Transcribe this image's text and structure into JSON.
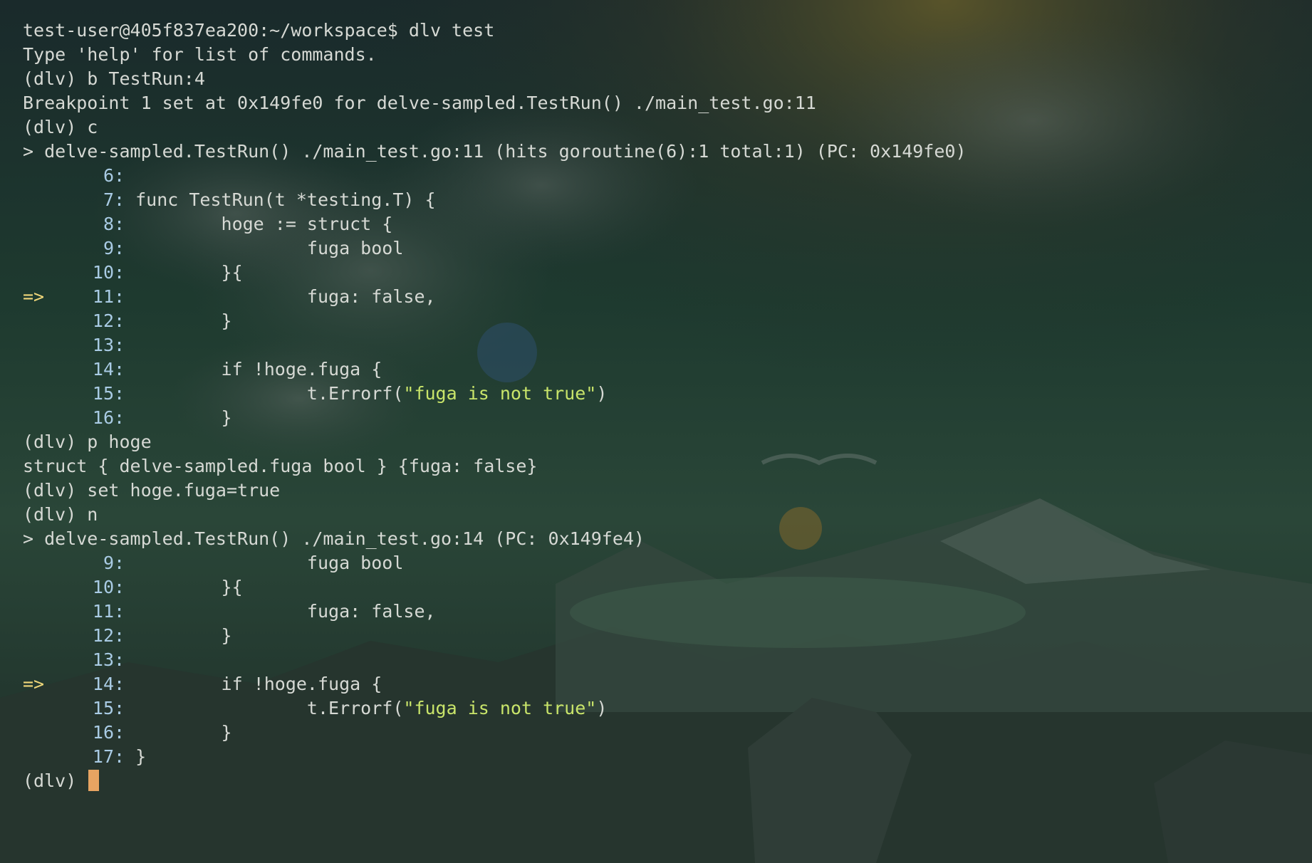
{
  "terminal": {
    "lines": [
      {
        "type": "out",
        "text": "test-user@405f837ea200:~/workspace$ dlv test"
      },
      {
        "type": "out",
        "text": "Type 'help' for list of commands."
      },
      {
        "type": "out",
        "text": "(dlv) b TestRun:4"
      },
      {
        "type": "out",
        "text": "Breakpoint 1 set at 0x149fe0 for delve-sampled.TestRun() ./main_test.go:11"
      },
      {
        "type": "out",
        "text": "(dlv) c"
      },
      {
        "type": "out",
        "text": "> delve-sampled.TestRun() ./main_test.go:11 (hits goroutine(6):1 total:1) (PC: 0x149fe0)"
      },
      {
        "type": "src",
        "pfx": "",
        "ln": "6",
        "code": ""
      },
      {
        "type": "src",
        "pfx": "",
        "ln": "7",
        "code": "func TestRun(t *testing.T) {"
      },
      {
        "type": "src",
        "pfx": "",
        "ln": "8",
        "code": "        hoge := struct {"
      },
      {
        "type": "src",
        "pfx": "",
        "ln": "9",
        "code": "                fuga bool"
      },
      {
        "type": "src",
        "pfx": "",
        "ln": "10",
        "code": "        }{"
      },
      {
        "type": "src",
        "pfx": "=>",
        "ln": "11",
        "code": "                fuga: false,"
      },
      {
        "type": "src",
        "pfx": "",
        "ln": "12",
        "code": "        }"
      },
      {
        "type": "src",
        "pfx": "",
        "ln": "13",
        "code": ""
      },
      {
        "type": "src",
        "pfx": "",
        "ln": "14",
        "code": "        if !hoge.fuga {"
      },
      {
        "type": "src",
        "pfx": "",
        "ln": "15",
        "code": "                t.Errorf(",
        "str": "\"fuga is not true\"",
        "tail": ")"
      },
      {
        "type": "src",
        "pfx": "",
        "ln": "16",
        "code": "        }"
      },
      {
        "type": "out",
        "text": "(dlv) p hoge"
      },
      {
        "type": "out",
        "text": "struct { delve-sampled.fuga bool } {fuga: false}"
      },
      {
        "type": "out",
        "text": "(dlv) set hoge.fuga=true"
      },
      {
        "type": "out",
        "text": "(dlv) n"
      },
      {
        "type": "out",
        "text": "> delve-sampled.TestRun() ./main_test.go:14 (PC: 0x149fe4)"
      },
      {
        "type": "src",
        "pfx": "",
        "ln": "9",
        "code": "                fuga bool"
      },
      {
        "type": "src",
        "pfx": "",
        "ln": "10",
        "code": "        }{"
      },
      {
        "type": "src",
        "pfx": "",
        "ln": "11",
        "code": "                fuga: false,"
      },
      {
        "type": "src",
        "pfx": "",
        "ln": "12",
        "code": "        }"
      },
      {
        "type": "src",
        "pfx": "",
        "ln": "13",
        "code": ""
      },
      {
        "type": "src",
        "pfx": "=>",
        "ln": "14",
        "code": "        if !hoge.fuga {"
      },
      {
        "type": "src",
        "pfx": "",
        "ln": "15",
        "code": "                t.Errorf(",
        "str": "\"fuga is not true\"",
        "tail": ")"
      },
      {
        "type": "src",
        "pfx": "",
        "ln": "16",
        "code": "        }"
      },
      {
        "type": "src",
        "pfx": "",
        "ln": "17",
        "code": "}"
      }
    ],
    "prompt": "(dlv) "
  },
  "colors": {
    "foreground": "#d6d9d4",
    "line_number": "#a9cbe4",
    "current_line_marker": "#f0d77a",
    "string_literal": "#c9e56a",
    "cursor": "#e7a462"
  }
}
